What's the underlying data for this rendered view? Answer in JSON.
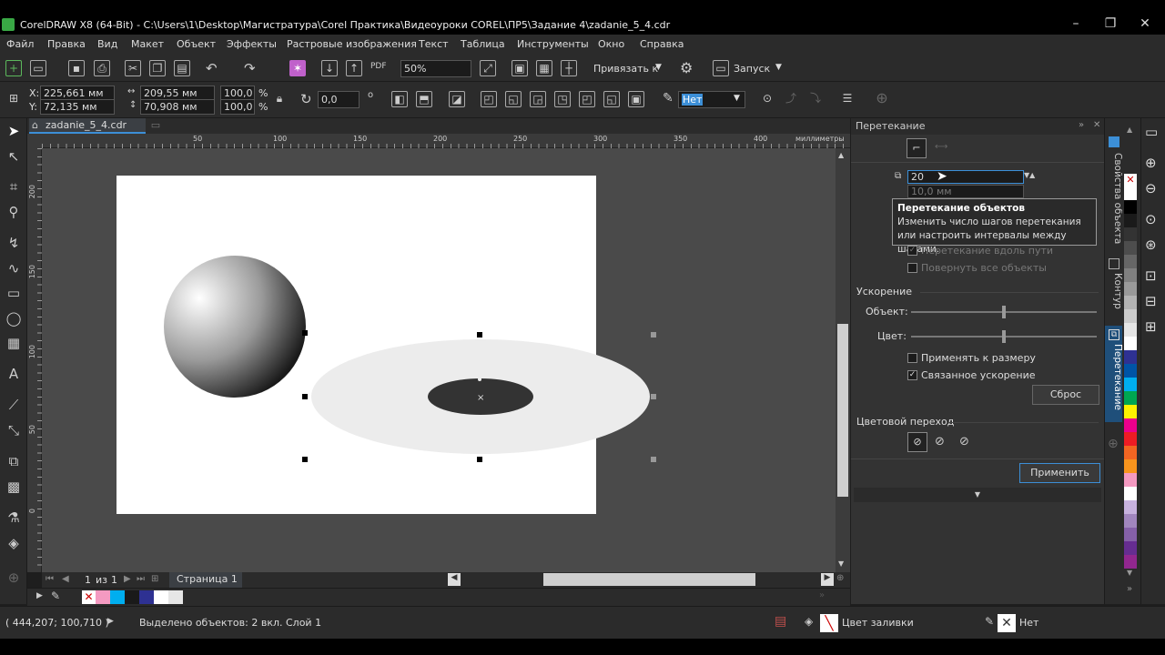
{
  "window": {
    "title": "CorelDRAW X8 (64-Bit) - C:\\Users\\1\\Desktop\\Магистратура\\Corel Практика\\Видеоуроки COREL\\ПР5\\Задание 4\\zadanie_5_4.cdr",
    "minimize": "–",
    "maximize": "❐",
    "close": "✕"
  },
  "menu": [
    "Файл",
    "Правка",
    "Вид",
    "Макет",
    "Объект",
    "Эффекты",
    "Растровые изображения",
    "Текст",
    "Таблица",
    "Инструменты",
    "Окно",
    "Справка"
  ],
  "toolbar": {
    "zoom": "50%",
    "snap_label": "Привязать к",
    "launch_label": "Запуск"
  },
  "propbar": {
    "x_label": "X:",
    "x_value": "225,661 мм",
    "y_label": "Y:",
    "y_value": "72,135 мм",
    "width_value": "209,55 мм",
    "height_value": "70,908 мм",
    "scale_x": "100,0",
    "scale_y": "100,0",
    "percent": "%",
    "rotation": "0,0",
    "outline_value": "Нет"
  },
  "document_tab": "zadanie_5_4.cdr",
  "ruler": {
    "h_ticks": [
      "0",
      "50",
      "100",
      "150",
      "200",
      "250",
      "300",
      "350",
      "400"
    ],
    "units": "миллиметры",
    "v_ticks": [
      "200",
      "150",
      "100",
      "50",
      "0"
    ]
  },
  "pagebar": {
    "page_counter_current": "1",
    "page_counter_sep": "из",
    "page_counter_total": "1",
    "page_tab": "Страница 1"
  },
  "status": {
    "coords": "( 444,207; 100,710 )",
    "selection": "Выделено объектов: 2 вкл. Слой 1",
    "fill_label": "Цвет заливки",
    "outline_label": "Нет"
  },
  "docker": {
    "title": "Перетекание",
    "steps_value": "20",
    "spacing_value": "10,0 мм",
    "tooltip_title": "Перетекание объектов",
    "tooltip_text": "Изменить число шагов перетекания или настроить интервалы между шагами.",
    "blend_along_path": "Перетекание вдоль пути",
    "rotate_all": "Повернуть все объекты",
    "accel_section": "Ускорение",
    "object_label": "Объект:",
    "color_label": "Цвет:",
    "object_accel": 0.5,
    "color_accel": 0.5,
    "apply_to_size": "Применять к размеру",
    "linked_accel": "Связанное ускорение",
    "reset_button": "Сброс",
    "color_transition_section": "Цветовой переход",
    "apply_button": "Применить"
  },
  "docker_tabs": [
    "Свойства объекта",
    "Контур",
    "Перетекание"
  ],
  "palette_colors": [
    "#ffffff",
    "#000000",
    "#1a1a1a",
    "#333333",
    "#4d4d4d",
    "#666666",
    "#808080",
    "#999999",
    "#b3b3b3",
    "#cccccc",
    "#e6e6e6",
    "#ffffff",
    "#2e3192",
    "#0054a6",
    "#00aeef",
    "#00a651",
    "#fff200",
    "#ec008c",
    "#ed1c24",
    "#f26522",
    "#f7941d",
    "#f49ac1",
    "#ffffff",
    "#c7b2de",
    "#a186be",
    "#8560a8",
    "#662d91",
    "#92278f"
  ],
  "doc_palette_colors": [
    "#f49ac1",
    "#00aeef",
    "#1a1a1a",
    "#2e3192",
    "#ffffff",
    "#e6e6e6"
  ]
}
